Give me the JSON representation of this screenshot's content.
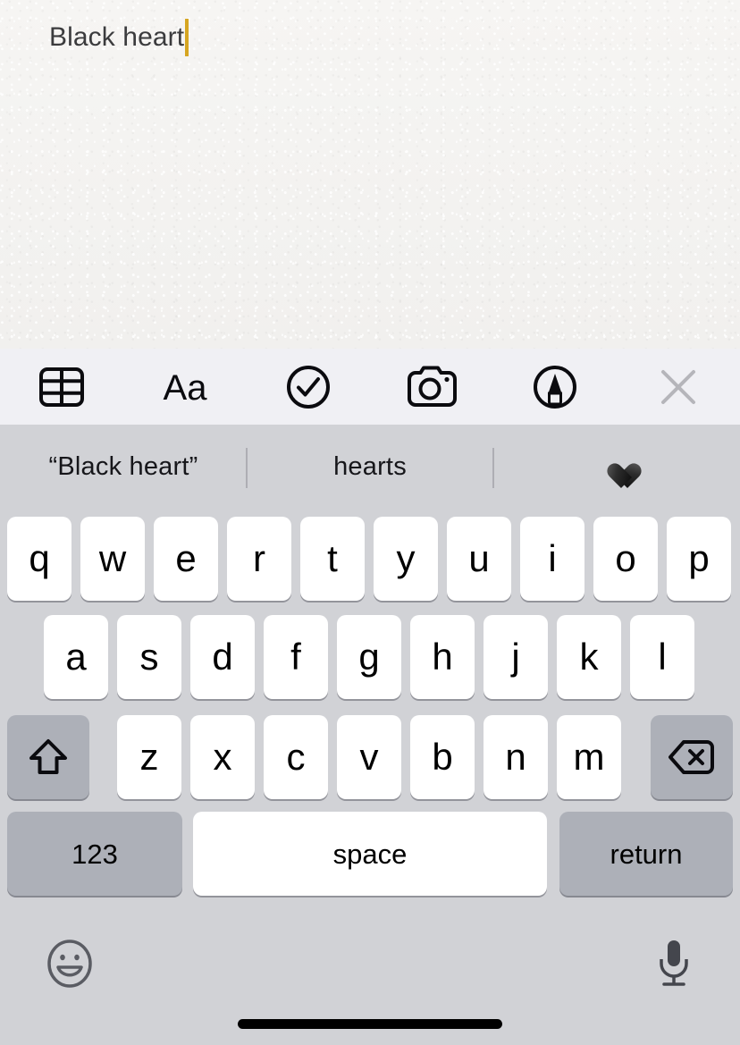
{
  "note": {
    "text": "Black heart",
    "caret_color": "#d6a521",
    "text_color": "#3b3b3d",
    "background_color": "#f4f3f1"
  },
  "toolbar": {
    "background_color": "#f0f0f4",
    "items": [
      {
        "icon": "table-icon",
        "label": "Table"
      },
      {
        "icon": "text-format-icon",
        "label": "Aa"
      },
      {
        "icon": "checklist-icon",
        "label": "Checklist"
      },
      {
        "icon": "camera-icon",
        "label": "Camera"
      },
      {
        "icon": "markup-pen-icon",
        "label": "Markup"
      },
      {
        "icon": "close-icon",
        "label": "Close"
      }
    ],
    "close_color": "#b5b5ba"
  },
  "predictive": {
    "background_color": "#d1d2d6",
    "candidates": [
      {
        "text": "“Black heart”",
        "type": "literal"
      },
      {
        "text": "hearts",
        "type": "word"
      },
      {
        "text": "🖤",
        "type": "emoji",
        "name": "black-heart-emoji"
      }
    ],
    "divider_color": "#aeaeb4"
  },
  "keyboard": {
    "background_color": "#d1d2d6",
    "key_color": "#ffffff",
    "modifier_key_color": "#adb0b8",
    "rows": [
      {
        "name": "row-1",
        "keys": [
          {
            "label": "q",
            "type": "letter"
          },
          {
            "label": "w",
            "type": "letter"
          },
          {
            "label": "e",
            "type": "letter"
          },
          {
            "label": "r",
            "type": "letter"
          },
          {
            "label": "t",
            "type": "letter"
          },
          {
            "label": "y",
            "type": "letter"
          },
          {
            "label": "u",
            "type": "letter"
          },
          {
            "label": "i",
            "type": "letter"
          },
          {
            "label": "o",
            "type": "letter"
          },
          {
            "label": "p",
            "type": "letter"
          }
        ]
      },
      {
        "name": "row-2",
        "keys": [
          {
            "label": "a",
            "type": "letter"
          },
          {
            "label": "s",
            "type": "letter"
          },
          {
            "label": "d",
            "type": "letter"
          },
          {
            "label": "f",
            "type": "letter"
          },
          {
            "label": "g",
            "type": "letter"
          },
          {
            "label": "h",
            "type": "letter"
          },
          {
            "label": "j",
            "type": "letter"
          },
          {
            "label": "k",
            "type": "letter"
          },
          {
            "label": "l",
            "type": "letter"
          }
        ]
      },
      {
        "name": "row-3",
        "keys": [
          {
            "label": "",
            "type": "shift",
            "icon": "shift-icon"
          },
          {
            "label": "z",
            "type": "letter"
          },
          {
            "label": "x",
            "type": "letter"
          },
          {
            "label": "c",
            "type": "letter"
          },
          {
            "label": "v",
            "type": "letter"
          },
          {
            "label": "b",
            "type": "letter"
          },
          {
            "label": "n",
            "type": "letter"
          },
          {
            "label": "m",
            "type": "letter"
          },
          {
            "label": "",
            "type": "backspace",
            "icon": "backspace-icon"
          }
        ]
      },
      {
        "name": "row-4",
        "keys": [
          {
            "label": "123",
            "type": "numeric"
          },
          {
            "label": "space",
            "type": "space"
          },
          {
            "label": "return",
            "type": "return"
          }
        ]
      }
    ]
  },
  "bottom_bar": {
    "background_color": "#d1d2d6",
    "emoji_button": {
      "icon": "emoji-smiley-icon",
      "label": "Emoji"
    },
    "dictation_button": {
      "icon": "microphone-icon",
      "label": "Dictation"
    },
    "home_indicator": true
  }
}
